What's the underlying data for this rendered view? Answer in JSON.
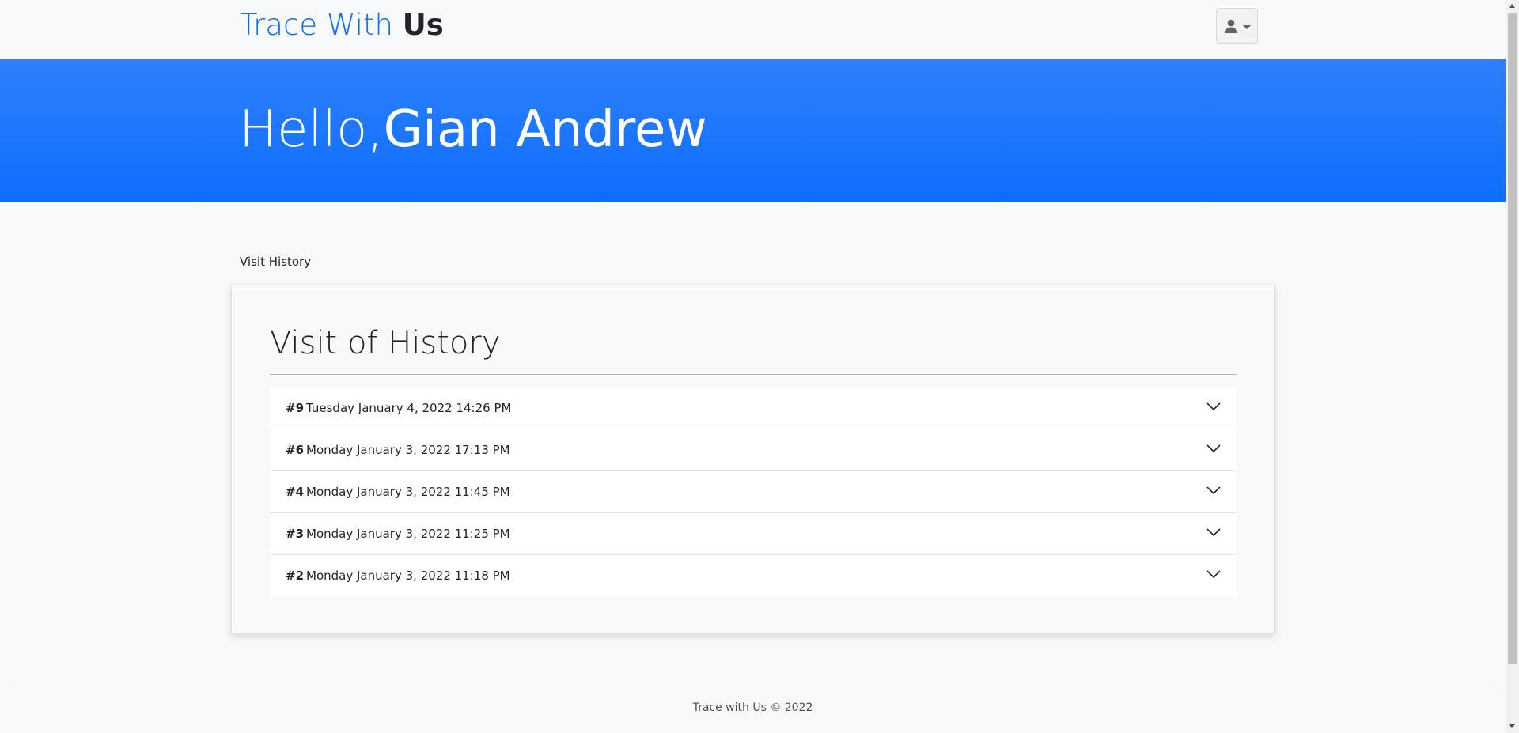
{
  "navbar": {
    "brand_light": "Trace With ",
    "brand_bold": "Us",
    "user_menu_icon": "user-icon",
    "caret_icon": "caret-down-icon"
  },
  "hero": {
    "greeting": "Hello,",
    "name": "Gian Andrew"
  },
  "breadcrumb": {
    "label": "Visit History"
  },
  "history": {
    "title": "Visit of History",
    "items": [
      {
        "num": "#9",
        "date": "Tuesday January 4, 2022 14:26 PM"
      },
      {
        "num": "#6",
        "date": "Monday January 3, 2022 17:13 PM"
      },
      {
        "num": "#4",
        "date": "Monday January 3, 2022 11:45 PM"
      },
      {
        "num": "#3",
        "date": "Monday January 3, 2022 11:25 PM"
      },
      {
        "num": "#2",
        "date": "Monday January 3, 2022 11:18 PM"
      }
    ],
    "expand_icon": "chevron-down-icon"
  },
  "footer": {
    "text": "Trace with Us © 2022"
  },
  "colors": {
    "primary": "#0d6efd",
    "background": "#f8f9fa"
  }
}
